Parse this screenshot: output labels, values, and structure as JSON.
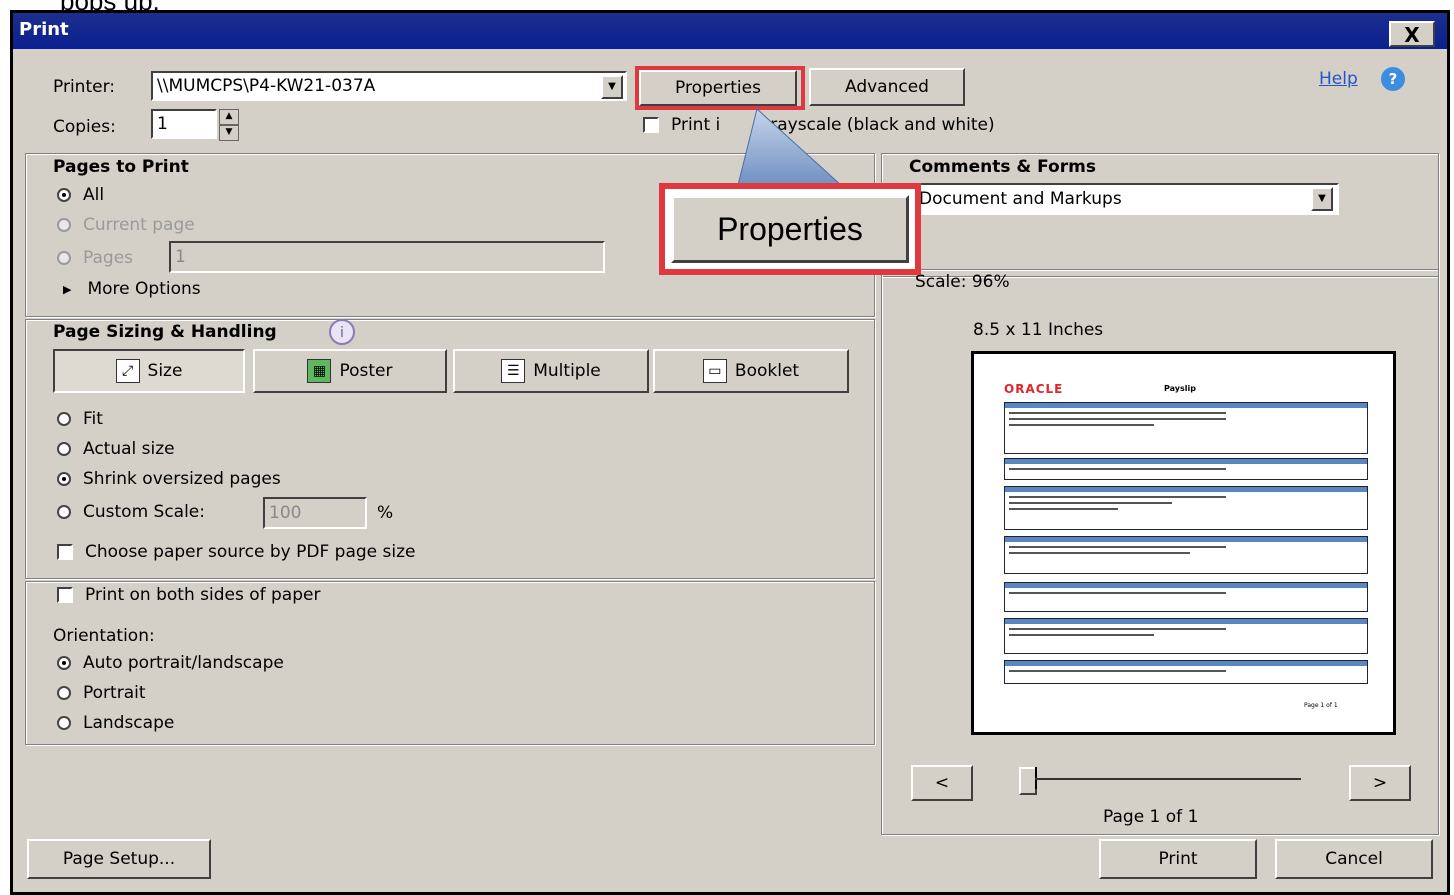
{
  "caption": "pops up.",
  "window": {
    "title": "Print",
    "close_label": "X"
  },
  "printer": {
    "label": "Printer:",
    "value": "\\\\MUMCPS\\P4-KW21-037A",
    "properties_label": "Properties",
    "advanced_label": "Advanced"
  },
  "copies": {
    "label": "Copies:",
    "value": "1"
  },
  "grayscale": {
    "label": "Print in grayscale (black and white)",
    "visible_prefix": "Print i",
    "visible_suffix": "rayscale (black and white)"
  },
  "help": {
    "label": "Help"
  },
  "callout": {
    "label": "Properties"
  },
  "pages_to_print": {
    "title": "Pages to Print",
    "all_label": "All",
    "current_label": "Current page",
    "pages_label": "Pages",
    "pages_value": "1",
    "more_options_label": "More Options"
  },
  "sizing": {
    "title": "Page Sizing & Handling",
    "buttons": [
      {
        "label": "Size",
        "icon": "size-icon"
      },
      {
        "label": "Poster",
        "icon": "poster-icon"
      },
      {
        "label": "Multiple",
        "icon": "multiple-icon"
      },
      {
        "label": "Booklet",
        "icon": "booklet-icon"
      }
    ],
    "fit_label": "Fit",
    "actual_label": "Actual size",
    "shrink_label": "Shrink oversized pages",
    "custom_label": "Custom Scale:",
    "custom_value": "100",
    "percent": "%",
    "paper_source_label": "Choose paper source by PDF page size"
  },
  "duplex": {
    "label": "Print on both sides of paper"
  },
  "orientation": {
    "title": "Orientation:",
    "auto_label": "Auto portrait/landscape",
    "portrait_label": "Portrait",
    "landscape_label": "Landscape"
  },
  "comments": {
    "title": "Comments & Forms",
    "value": "Document and Markups"
  },
  "preview": {
    "scale": "Scale: 96%",
    "size": "8.5 x 11 Inches",
    "brand": "ORACLE",
    "doc_title": "Payslip",
    "footer": "Page 1 of 1",
    "prev": "<",
    "next": ">",
    "page_label": "Page 1 of 1"
  },
  "footer": {
    "page_setup": "Page Setup...",
    "print": "Print",
    "cancel": "Cancel"
  },
  "colors": {
    "highlight": "#e0383f",
    "title_bar": "#0a2090",
    "dialog_bg": "#d4d0c8"
  }
}
